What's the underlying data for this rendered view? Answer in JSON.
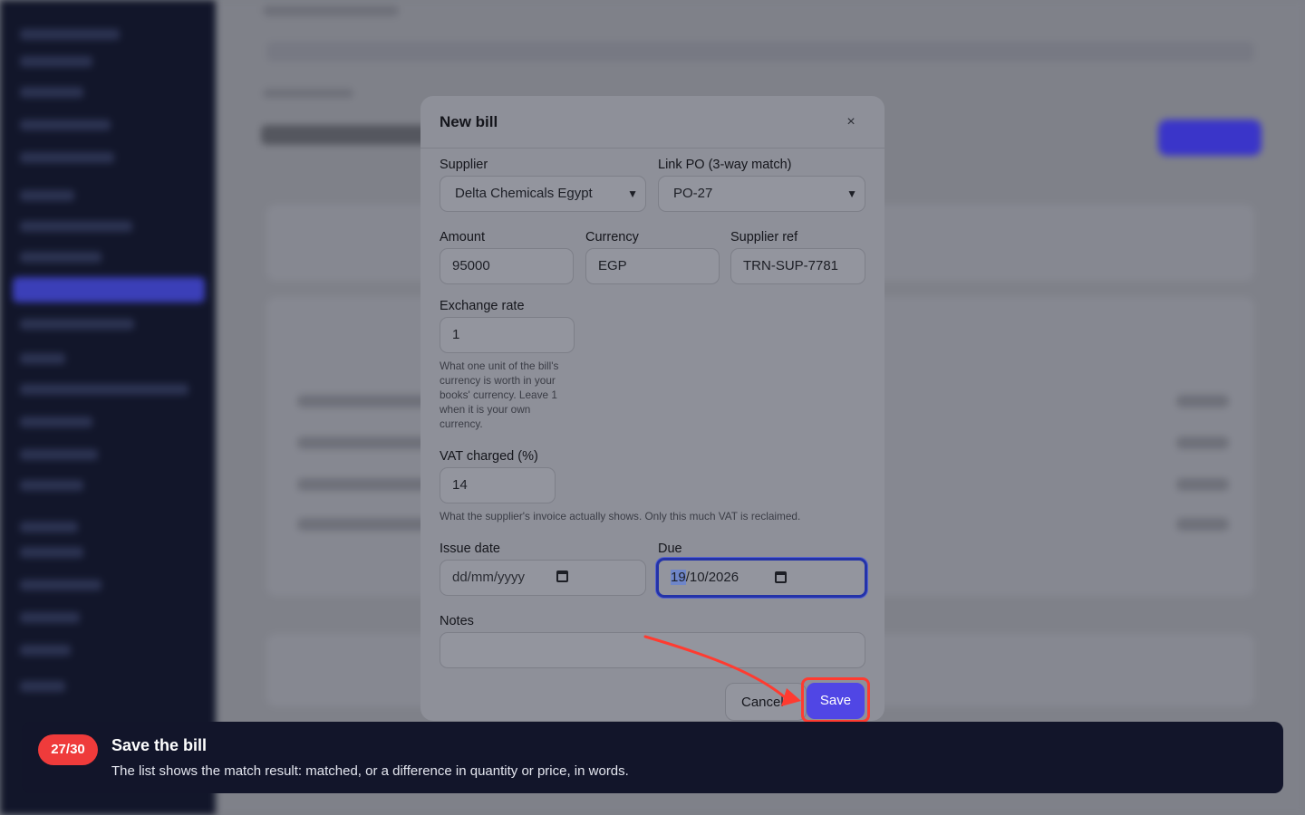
{
  "modal": {
    "title": "New bill",
    "close_icon": "×",
    "supplier": {
      "label": "Supplier",
      "value": "Delta Chemicals Egypt"
    },
    "link_po": {
      "label": "Link PO (3-way match)",
      "value": "PO-27"
    },
    "amount": {
      "label": "Amount",
      "value": "95000"
    },
    "currency": {
      "label": "Currency",
      "value": "EGP"
    },
    "supplier_ref": {
      "label": "Supplier ref",
      "value": "TRN-SUP-7781"
    },
    "exchange_rate": {
      "label": "Exchange rate",
      "value": "1",
      "help_lines": [
        "What one unit of the bill's",
        "currency is worth in your",
        "books' currency. Leave 1",
        "when it is your own",
        "currency."
      ]
    },
    "vat": {
      "label": "VAT charged (%)",
      "value": "14",
      "help": "What the supplier's invoice actually shows. Only this much VAT is reclaimed."
    },
    "issue_date": {
      "label": "Issue date",
      "placeholder": "dd/mm/yyyy"
    },
    "due": {
      "label": "Due",
      "day": "19",
      "rest": "/10/2026"
    },
    "notes": {
      "label": "Notes",
      "value": ""
    },
    "cancel_label": "Cancel",
    "save_label": "Save"
  },
  "tutorial": {
    "step": "27/30",
    "title": "Save the bill",
    "text": "The list shows the match result: matched, or a difference in quantity or price, in words."
  },
  "colors": {
    "accent": "#5046e5",
    "highlight": "#ff3b30",
    "banner_bg": "#12152a",
    "badge": "#ef3b3b"
  },
  "icons": [
    "close-icon",
    "chevron-down-icon",
    "calendar-icon",
    "arrow-pointer-icon"
  ]
}
